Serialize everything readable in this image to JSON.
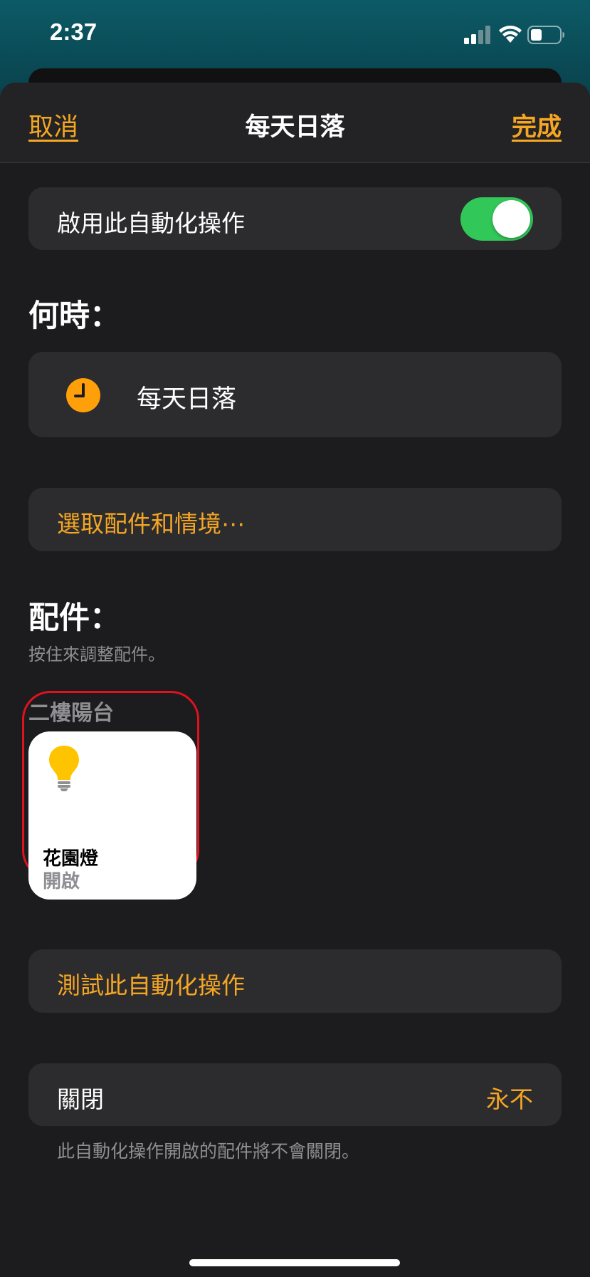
{
  "status_bar": {
    "time": "2:37"
  },
  "nav": {
    "cancel_label": "取消",
    "title": "每天日落",
    "done_label": "完成"
  },
  "enable": {
    "label": "啟用此自動化操作",
    "toggle_state": "on"
  },
  "when": {
    "section_title": "何時：",
    "trigger_label": "每天日落"
  },
  "select_accessories": {
    "label": "選取配件和情境⋯"
  },
  "accessories": {
    "section_title": "配件：",
    "subtitle": "按住來調整配件。",
    "room": "二樓陽台",
    "items": [
      {
        "name": "花園燈",
        "status": "開啟",
        "icon": "lightbulb-icon"
      }
    ]
  },
  "test": {
    "label": "測試此自動化操作"
  },
  "turn_off": {
    "label": "關閉",
    "value": "永不",
    "footnote": "此自動化操作開啟的配件將不會關閉。"
  },
  "colors": {
    "accent": "#f5a623",
    "toggle_on": "#32c759",
    "background": "#1c1c1e",
    "cell": "#2c2c2e",
    "highlight": "#e0121e"
  }
}
